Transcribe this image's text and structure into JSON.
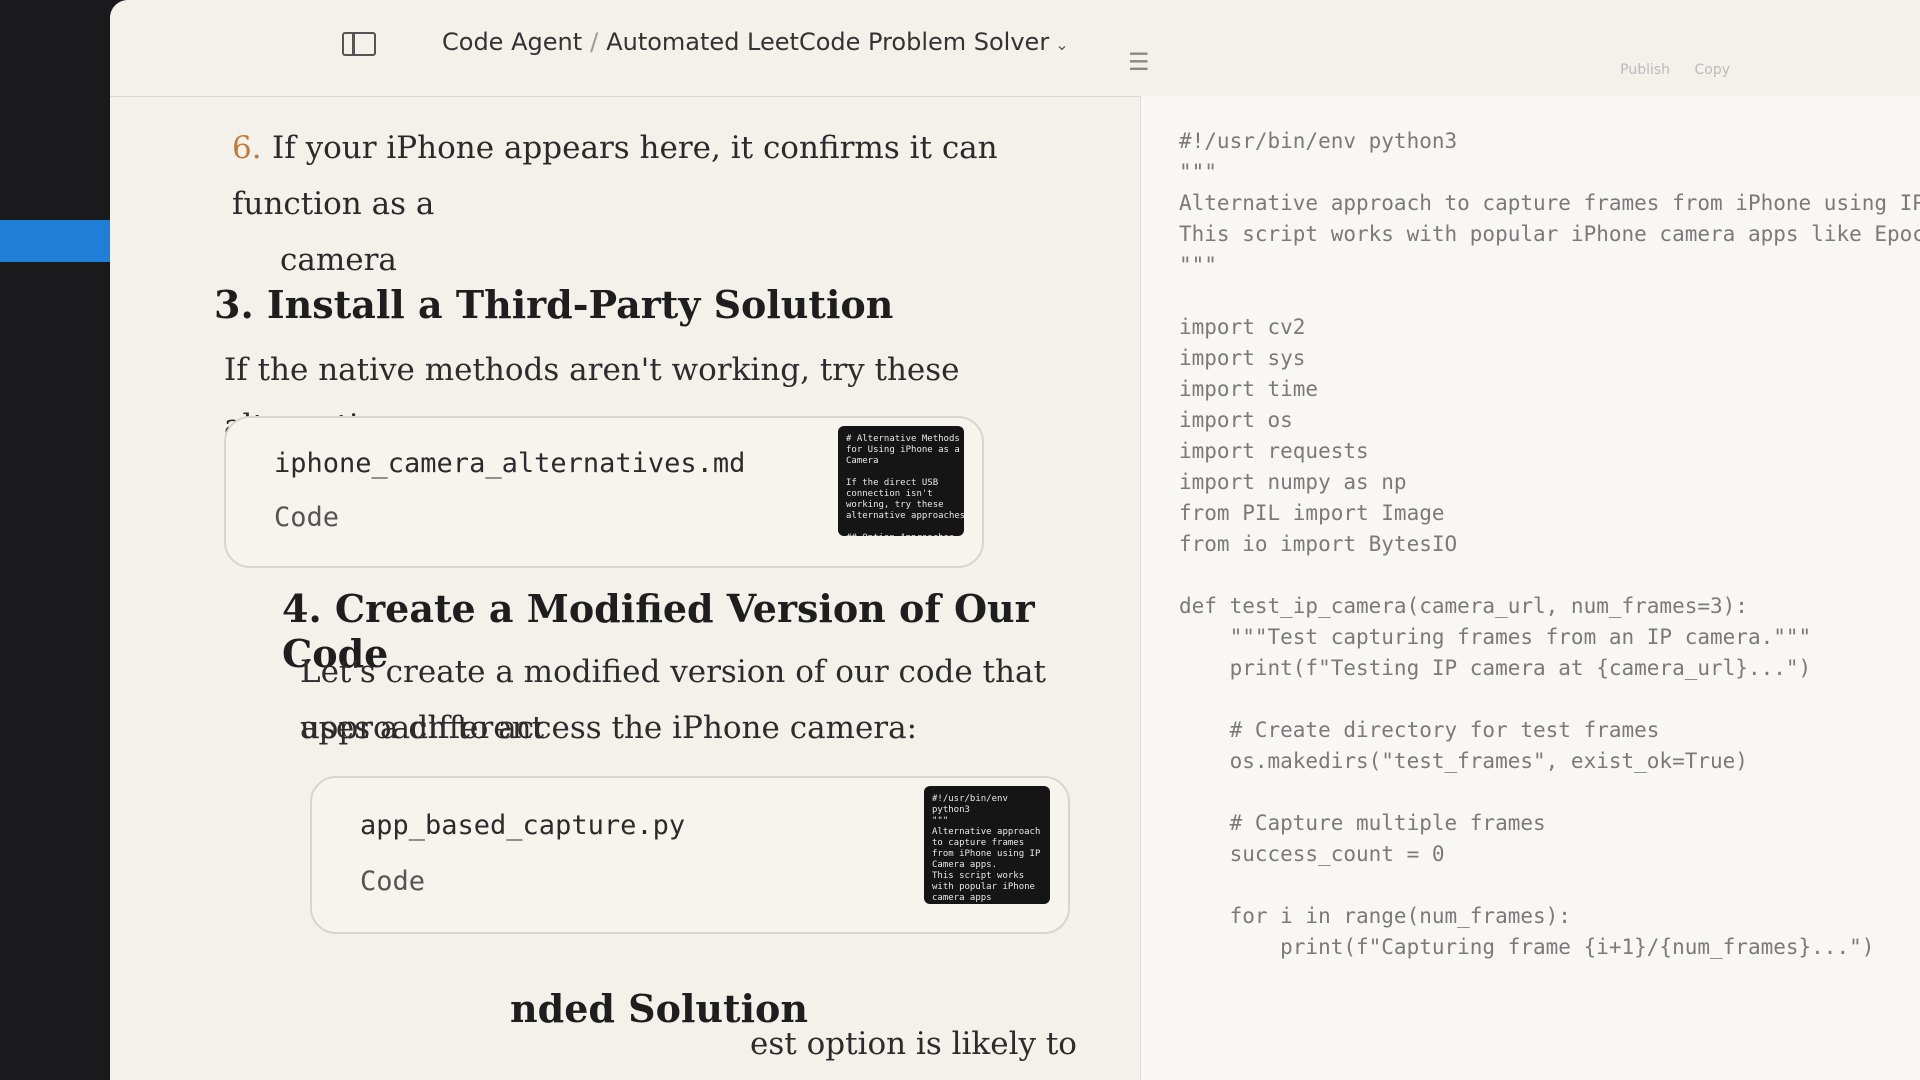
{
  "header": {
    "project": "Code Agent",
    "separator": "/",
    "conversation": "Automated LeetCode Problem Solver",
    "caret": "⌄",
    "toc_icon": "☰",
    "publish_label": "Publish",
    "copy_label": "Copy"
  },
  "chat": {
    "step6_number": "6.",
    "step6_line1": "If your iPhone appears here, it confirms it can function as a",
    "step6_line2": "camera",
    "section3_heading": "3. Install a Third-Party Solution",
    "section3_text": "If the native methods aren't working, try these alternatives:",
    "artifact1": {
      "filename": "iphone_camera_alternatives.md",
      "type": "Code",
      "preview": "# Alternative Methods\nfor Using iPhone as a\nCamera\n\nIf the direct USB\nconnection isn't\nworking, try these\nalternative approaches\n\n## Option Approaches"
    },
    "section4_heading": "4. Create a Modified Version of Our Code",
    "section4_line1": "Let's create a modified version of our code that uses a different",
    "section4_line2": "approach to access the iPhone camera:",
    "artifact2": {
      "filename": "app_based_capture.py",
      "type": "Code",
      "preview": "#!/usr/bin/env\npython3\n\"\"\"\nAlternative approach\nto capture frames\nfrom iPhone using IP\nCamera apps.\nThis script works\nwith popular iPhone\ncamera apps"
    },
    "section5_heading_partial": "nded Solution",
    "section5_text_partial": "est option is likely to use an IP"
  },
  "code": {
    "lines": [
      "#!/usr/bin/env python3",
      "\"\"\"",
      "Alternative approach to capture frames from iPhone using IP Camera",
      "This script works with popular iPhone camera apps like EpocCam, D",
      "\"\"\"",
      "",
      "import cv2",
      "import sys",
      "import time",
      "import os",
      "import requests",
      "import numpy as np",
      "from PIL import Image",
      "from io import BytesIO",
      "",
      "def test_ip_camera(camera_url, num_frames=3):",
      "    \"\"\"Test capturing frames from an IP camera.\"\"\"",
      "    print(f\"Testing IP camera at {camera_url}...\")",
      "",
      "    # Create directory for test frames",
      "    os.makedirs(\"test_frames\", exist_ok=True)",
      "",
      "    # Capture multiple frames",
      "    success_count = 0",
      "",
      "    for i in range(num_frames):",
      "        print(f\"Capturing frame {i+1}/{num_frames}...\")"
    ]
  }
}
